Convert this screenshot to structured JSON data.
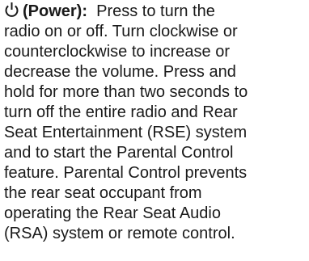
{
  "entry": {
    "icon": "power-icon",
    "term": "(Power):",
    "lines": [
      "Press to turn the",
      "radio on or off. Turn clockwise or",
      "counterclockwise to increase or",
      "decrease the volume. Press and",
      "hold for more than two seconds to",
      "turn off the entire radio and Rear",
      "Seat Entertainment (RSE) system",
      "and to start the Parental Control",
      "feature. Parental Control prevents",
      "the rear seat occupant from",
      "operating the Rear Seat Audio",
      "(RSA) system or remote control."
    ]
  }
}
